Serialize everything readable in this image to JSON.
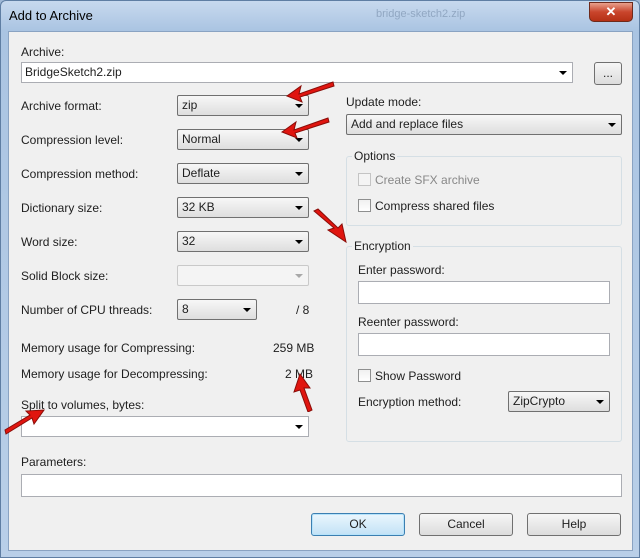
{
  "window": {
    "title": "Add to Archive",
    "close_glyph": "✕",
    "background_title": "bridge-sketch2.zip"
  },
  "archive": {
    "label": "Archive:",
    "value": "BridgeSketch2.zip",
    "browse_label": "..."
  },
  "left": {
    "format": {
      "label": "Archive format:",
      "value": "zip"
    },
    "level": {
      "label": "Compression level:",
      "value": "Normal"
    },
    "method": {
      "label": "Compression method:",
      "value": "Deflate"
    },
    "dict": {
      "label": "Dictionary size:",
      "value": "32 KB"
    },
    "word": {
      "label": "Word size:",
      "value": "32"
    },
    "solid": {
      "label": "Solid Block size:",
      "value": ""
    },
    "threads": {
      "label": "Number of CPU threads:",
      "value": "8",
      "max": "/ 8"
    },
    "mem_comp": {
      "label": "Memory usage for Compressing:",
      "value": "259 MB"
    },
    "mem_decomp": {
      "label": "Memory usage for Decompressing:",
      "value": "2 MB"
    },
    "split": {
      "label": "Split to volumes, bytes:",
      "value": ""
    }
  },
  "right": {
    "update": {
      "label": "Update mode:",
      "value": "Add and replace files"
    },
    "options": {
      "title": "Options",
      "sfx": "Create SFX archive",
      "shared": "Compress shared files"
    },
    "encryption": {
      "title": "Encryption",
      "enter_label": "Enter password:",
      "reenter_label": "Reenter password:",
      "show_label": "Show Password",
      "method_label": "Encryption method:",
      "method_value": "ZipCrypto"
    }
  },
  "parameters": {
    "label": "Parameters:",
    "value": ""
  },
  "buttons": {
    "ok": "OK",
    "cancel": "Cancel",
    "help": "Help"
  },
  "colors": {
    "annotation_arrow": "#e0150f",
    "window_frame": "#aac4e2",
    "client_bg": "#f0f0f0"
  }
}
